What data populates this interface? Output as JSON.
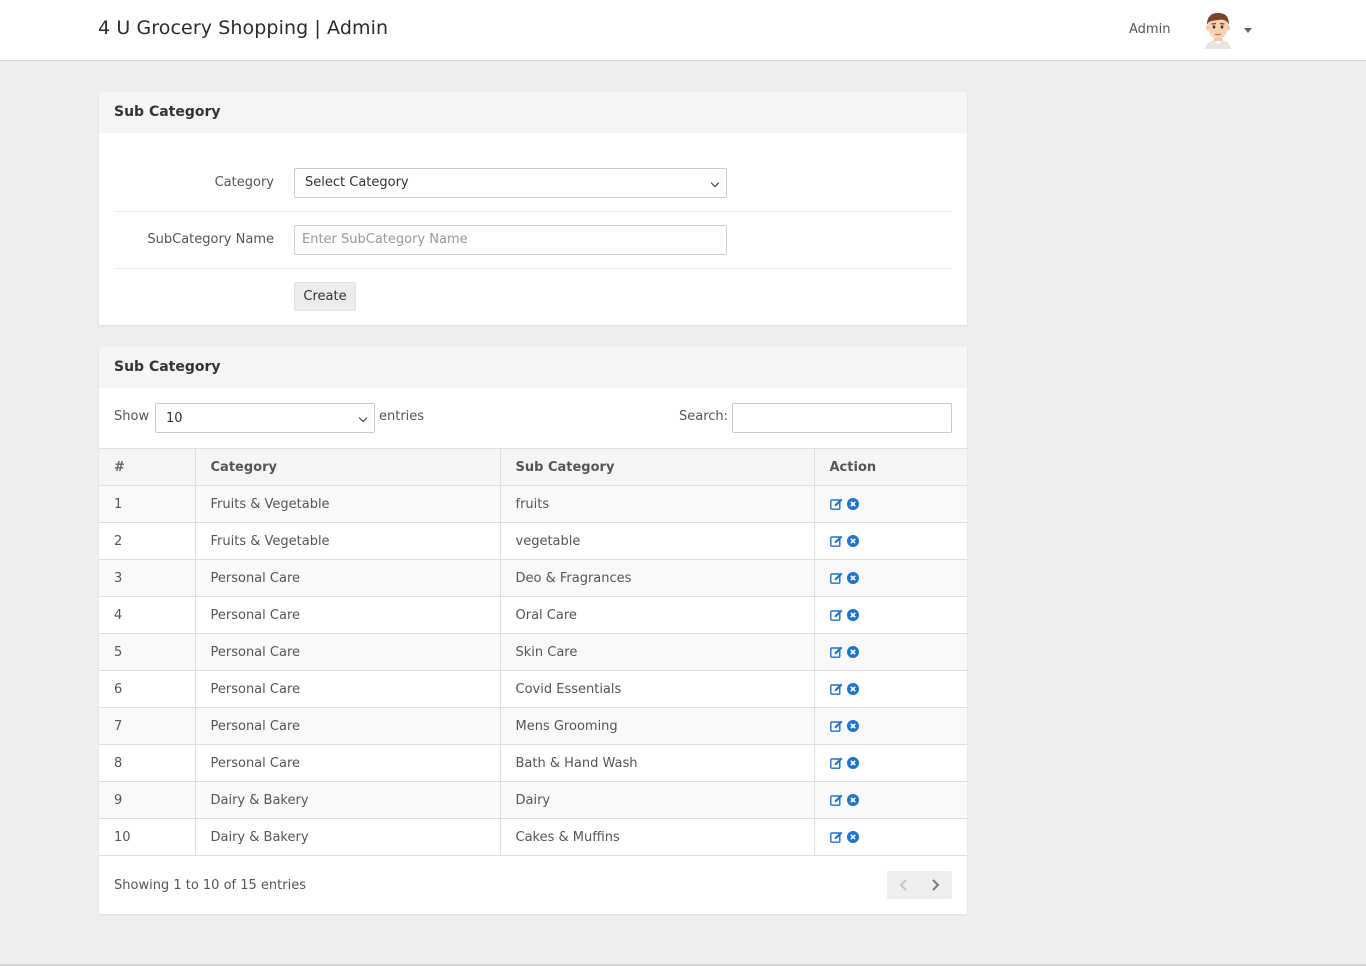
{
  "header": {
    "brand": "4 U Grocery Shopping | Admin",
    "user_label": "Admin",
    "avatar_icon": "avatar-icon",
    "menu_icon": "caret-down-icon"
  },
  "form_panel": {
    "title": "Sub Category",
    "category_label": "Category",
    "category_selected": "Select Category",
    "subcategory_label": "SubCategory Name",
    "subcategory_placeholder": "Enter SubCategory Name",
    "create_label": "Create"
  },
  "table_panel": {
    "title": "Sub Category",
    "show_label": "Show",
    "page_length": "10",
    "entries_label": "entries",
    "search_label": "Search:",
    "search_value": "",
    "columns": [
      "#",
      "Category",
      "Sub Category",
      "Action"
    ],
    "rows": [
      {
        "num": "1",
        "category": "Fruits & Vegetable",
        "sub": "fruits"
      },
      {
        "num": "2",
        "category": "Fruits & Vegetable",
        "sub": "vegetable"
      },
      {
        "num": "3",
        "category": "Personal Care",
        "sub": "Deo & Fragrances"
      },
      {
        "num": "4",
        "category": "Personal Care",
        "sub": "Oral Care"
      },
      {
        "num": "5",
        "category": "Personal Care",
        "sub": "Skin Care"
      },
      {
        "num": "6",
        "category": "Personal Care",
        "sub": "Covid Essentials"
      },
      {
        "num": "7",
        "category": "Personal Care",
        "sub": "Mens Grooming"
      },
      {
        "num": "8",
        "category": "Personal Care",
        "sub": "Bath & Hand Wash"
      },
      {
        "num": "9",
        "category": "Dairy & Bakery",
        "sub": "Dairy"
      },
      {
        "num": "10",
        "category": "Dairy & Bakery",
        "sub": "Cakes & Muffins"
      }
    ],
    "info": "Showing 1 to 10 of 15 entries",
    "action_icons": [
      "edit-icon",
      "delete-icon"
    ],
    "pager_icons": [
      "chevron-left-icon",
      "chevron-right-icon"
    ]
  },
  "colors": {
    "accent": "#1f73c8",
    "background": "#eeeeee",
    "panel_header": "#f5f5f5"
  }
}
